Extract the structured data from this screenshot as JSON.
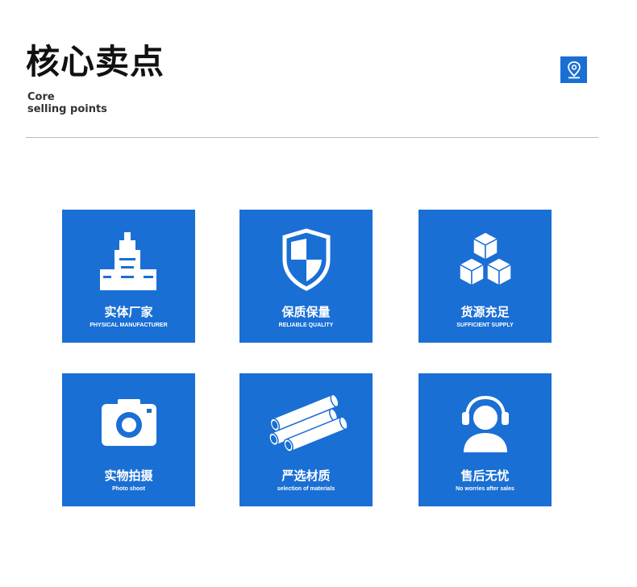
{
  "header": {
    "title": "核心卖点",
    "subtitle_line1": "Core",
    "subtitle_line2": "selling points",
    "location_icon": "map-pin-icon"
  },
  "colors": {
    "accent": "#1a6fd4",
    "divider": "#bdbdbd",
    "title_text": "#111111"
  },
  "cards": [
    {
      "title": "实体厂家",
      "subtitle": "PHYSICAL MANUFACTURER",
      "icon": "factory-icon"
    },
    {
      "title": "保质保量",
      "subtitle": "RELIABLE QUALITY",
      "icon": "shield-icon"
    },
    {
      "title": "货源充足",
      "subtitle": "SUFFICIENT SUPPLY",
      "icon": "boxes-icon"
    },
    {
      "title": "实物拍摄",
      "subtitle": "Photo shoot",
      "icon": "camera-icon"
    },
    {
      "title": "严选材质",
      "subtitle": "selection of materials",
      "icon": "pipes-icon"
    },
    {
      "title": "售后无忧",
      "subtitle": "No worries after sales",
      "icon": "headset-support-icon"
    }
  ]
}
